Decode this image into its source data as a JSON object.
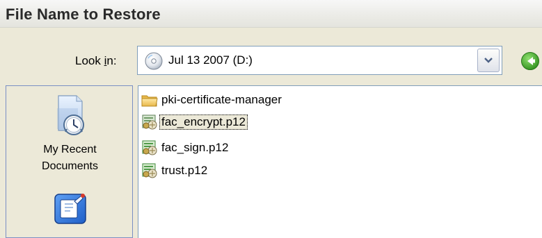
{
  "window": {
    "title": "File Name to Restore"
  },
  "toolbar": {
    "lookin_prefix": "Look ",
    "lookin_accel": "i",
    "lookin_suffix": "n:",
    "current_location": "Jul 13 2007 (D:)"
  },
  "places": [
    {
      "label_line1": "My Recent",
      "label_line2": "Documents",
      "icon": "recent-documents-icon"
    },
    {
      "label_line1": "",
      "label_line2": "",
      "icon": "desktop-icon"
    }
  ],
  "files": [
    {
      "name": "pki-certificate-manager",
      "type": "folder",
      "icon": "folder-icon",
      "selected": false
    },
    {
      "name": "fac_encrypt.p12",
      "type": "certificate",
      "icon": "certificate-file-icon",
      "selected": true
    },
    {
      "name": "fac_sign.p12",
      "type": "certificate",
      "icon": "certificate-file-icon",
      "selected": false
    },
    {
      "name": "trust.p12",
      "type": "certificate",
      "icon": "certificate-file-icon",
      "selected": false
    }
  ],
  "colors": {
    "title_bar": "#ebebe6",
    "dialog_bg": "#ece9d8",
    "places_bar": "#ece9d8",
    "field_border": "#7f9db9",
    "back_button": "#3a9d23"
  }
}
